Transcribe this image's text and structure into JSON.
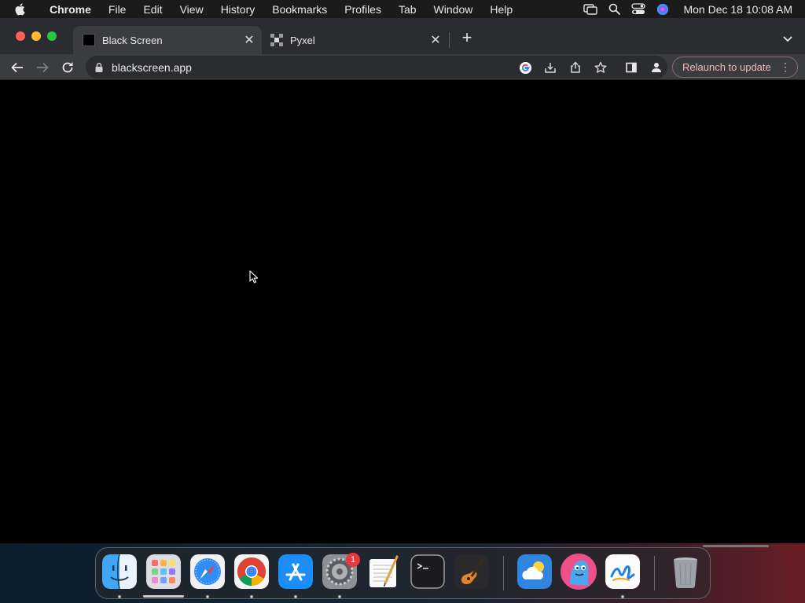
{
  "menubar": {
    "apple_icon": "apple-logo-icon",
    "app_name": "Chrome",
    "items": [
      "File",
      "Edit",
      "View",
      "History",
      "Bookmarks",
      "Profiles",
      "Tab",
      "Window",
      "Help"
    ],
    "status_icons": [
      "screen-mirroring-icon",
      "spotlight-search-icon",
      "control-center-icon",
      "siri-icon"
    ],
    "clock": "Mon Dec 18  10:08 AM"
  },
  "tabs": [
    {
      "title": "Black Screen",
      "favicon": "black-square-icon",
      "active": true
    },
    {
      "title": "Pyxel",
      "favicon": "pyxel-icon",
      "active": false
    }
  ],
  "toolbar": {
    "url": "blackscreen.app",
    "relaunch_label": "Relaunch to update"
  },
  "dock": {
    "apps": [
      "Finder",
      "Launchpad",
      "Safari",
      "Google Chrome",
      "App Store",
      "System Settings",
      "TextEdit",
      "Terminal",
      "GarageBand",
      "Weather",
      "Pinniped",
      "Freeform",
      "Trash"
    ],
    "settings_badge": "1"
  },
  "colors": {
    "menubar_bg": "#1b1b1c",
    "tabstrip_bg": "#2b2c30",
    "toolbar_bg": "#3b3c40",
    "content_bg": "#000000",
    "relaunch_text": "#f2b8b5",
    "badge": "#e8383b"
  }
}
